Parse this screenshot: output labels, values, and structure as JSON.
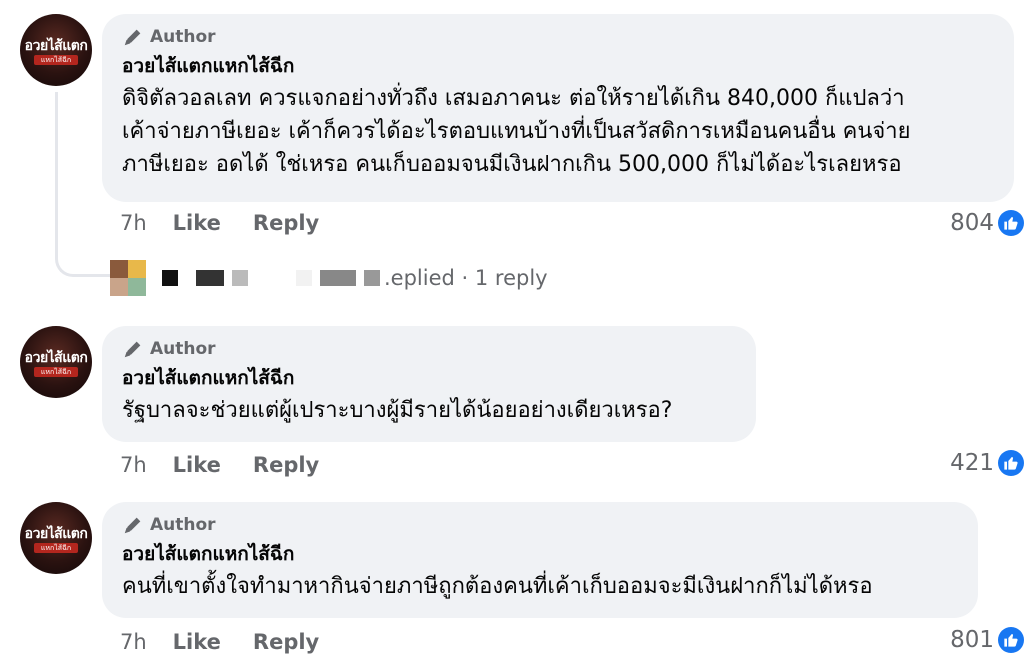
{
  "comments": [
    {
      "avatar_text": "อวยไส้แตก",
      "avatar_sub": "แหกไส้ฉีก",
      "author_badge": "Author",
      "name": "อวยไส้แตกแหกไส้ฉีก",
      "lines": [
        "ดิจิตัลวอลเลท ควรแจกอย่างทั่วถึง เสมอภาคนะ ต่อให้รายได้เกิน 840,000 ก็แปลว่า",
        "เค้าจ่ายภาษีเยอะ เค้าก็ควรได้อะไรตอบแทนบ้างที่เป็นสวัสดิการเหมือนคนอื่น คนจ่าย",
        "ภาษีเยอะ อดได้ ใช่เหรอ คนเก็บออมจนมีเงินฝากเกิน 500,000 ก็ไม่ได้อะไรเลยหรอ"
      ],
      "time": "7h",
      "like_label": "Like",
      "reply_label": "Reply",
      "reaction_count": "804",
      "reaction_icon": "like-icon",
      "replies_text": ".eplied · 1 reply"
    },
    {
      "avatar_text": "อวยไส้แตก",
      "avatar_sub": "แหกไส้ฉีก",
      "author_badge": "Author",
      "name": "อวยไส้แตกแหกไส้ฉีก",
      "lines": [
        "รัฐบาลจะช่วยแต่ผู้เปราะบางผู้มีรายได้น้อยอย่างเดียวเหรอ?"
      ],
      "time": "7h",
      "like_label": "Like",
      "reply_label": "Reply",
      "reaction_count": "421",
      "reaction_icon": "like-icon"
    },
    {
      "avatar_text": "อวยไส้แตก",
      "avatar_sub": "แหกไส้ฉีก",
      "author_badge": "Author",
      "name": "อวยไส้แตกแหกไส้ฉีก",
      "lines": [
        "คนที่เขาตั้งใจทำมาหากินจ่ายภาษีถูกต้องคนที่เค้าเก็บออมจะมีเงินฝากก็ไม่ได้หรอ"
      ],
      "time": "7h",
      "like_label": "Like",
      "reply_label": "Reply",
      "reaction_count": "801",
      "reaction_icon": "like-icon"
    }
  ],
  "colors": {
    "bubble": "#f0f2f5",
    "meta_text": "#65676b",
    "like_blue": "#1877f2"
  }
}
